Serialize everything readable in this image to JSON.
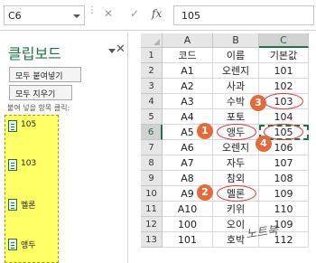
{
  "formula_bar": {
    "name_box": "C6",
    "cancel_glyph": "✕",
    "enter_glyph": "✓",
    "fx_label": "fx",
    "value": "105"
  },
  "clipboard_pane": {
    "title": "클립보드",
    "close_glyph": "✕",
    "paste_all_label": "모두 붙여넣기",
    "clear_all_label": "모두 지우기",
    "items_label": "붙여 넣을 항목 클릭:",
    "items": [
      {
        "text": "105",
        "icon": "excel-clip-icon"
      },
      {
        "text": "103",
        "icon": "excel-clip-icon"
      },
      {
        "text": "멜론",
        "icon": "excel-clip-icon"
      },
      {
        "text": "앵두",
        "icon": "excel-clip-icon"
      }
    ],
    "highlight_color": "#ffff66"
  },
  "sheet": {
    "columns": [
      "A",
      "B",
      "C"
    ],
    "rows": [
      {
        "num": "1",
        "cells": [
          "코드",
          "이름",
          "기본값"
        ]
      },
      {
        "num": "2",
        "cells": [
          "A1",
          "오렌지",
          "101"
        ]
      },
      {
        "num": "3",
        "cells": [
          "A2",
          "사과",
          "102"
        ]
      },
      {
        "num": "4",
        "cells": [
          "A3",
          "수박",
          "103"
        ]
      },
      {
        "num": "5",
        "cells": [
          "A4",
          "포토",
          "104"
        ]
      },
      {
        "num": "6",
        "cells": [
          "A5",
          "앵두",
          "105"
        ]
      },
      {
        "num": "7",
        "cells": [
          "A6",
          "오렌지",
          "106"
        ]
      },
      {
        "num": "8",
        "cells": [
          "A7",
          "자두",
          "107"
        ]
      },
      {
        "num": "9",
        "cells": [
          "A8",
          "참외",
          "108"
        ]
      },
      {
        "num": "10",
        "cells": [
          "A9",
          "멜론",
          "109"
        ]
      },
      {
        "num": "11",
        "cells": [
          "A10",
          "키위",
          "110"
        ]
      },
      {
        "num": "12",
        "cells": [
          "100",
          "오이",
          "109"
        ]
      },
      {
        "num": "13",
        "cells": [
          "101",
          "호박",
          "112"
        ]
      }
    ],
    "selected_cell": "C6",
    "accent_color": "#217346"
  },
  "annotations": {
    "badges": [
      "1",
      "2",
      "3",
      "4"
    ],
    "color": "#e26a3b"
  },
  "watermark": "노트북"
}
